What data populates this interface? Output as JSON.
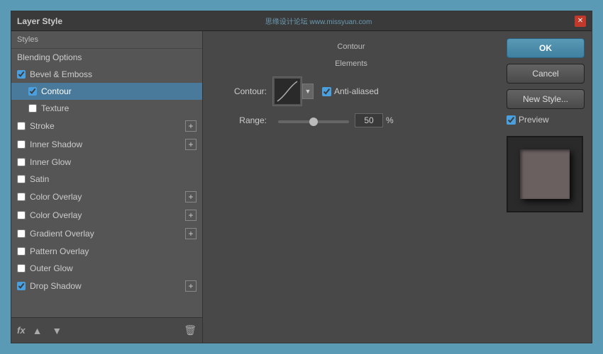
{
  "dialog": {
    "title": "Layer Style",
    "watermark": "思缘设计论坛  www.missyuan.com"
  },
  "left_panel": {
    "header": "Styles",
    "items": [
      {
        "id": "blending-options",
        "label": "Blending Options",
        "checked": null,
        "indent": 0,
        "has_plus": false,
        "active": false
      },
      {
        "id": "bevel-emboss",
        "label": "Bevel & Emboss",
        "checked": true,
        "indent": 0,
        "has_plus": false,
        "active": false
      },
      {
        "id": "contour",
        "label": "Contour",
        "checked": true,
        "indent": 1,
        "has_plus": false,
        "active": true
      },
      {
        "id": "texture",
        "label": "Texture",
        "checked": false,
        "indent": 1,
        "has_plus": false,
        "active": false
      },
      {
        "id": "stroke",
        "label": "Stroke",
        "checked": false,
        "indent": 0,
        "has_plus": true,
        "active": false
      },
      {
        "id": "inner-shadow",
        "label": "Inner Shadow",
        "checked": false,
        "indent": 0,
        "has_plus": true,
        "active": false
      },
      {
        "id": "inner-glow",
        "label": "Inner Glow",
        "checked": false,
        "indent": 0,
        "has_plus": false,
        "active": false
      },
      {
        "id": "satin",
        "label": "Satin",
        "checked": false,
        "indent": 0,
        "has_plus": false,
        "active": false
      },
      {
        "id": "color-overlay-1",
        "label": "Color Overlay",
        "checked": false,
        "indent": 0,
        "has_plus": true,
        "active": false
      },
      {
        "id": "color-overlay-2",
        "label": "Color Overlay",
        "checked": false,
        "indent": 0,
        "has_plus": true,
        "active": false
      },
      {
        "id": "gradient-overlay",
        "label": "Gradient Overlay",
        "checked": false,
        "indent": 0,
        "has_plus": true,
        "active": false
      },
      {
        "id": "pattern-overlay",
        "label": "Pattern Overlay",
        "checked": false,
        "indent": 0,
        "has_plus": false,
        "active": false
      },
      {
        "id": "outer-glow",
        "label": "Outer Glow",
        "checked": false,
        "indent": 0,
        "has_plus": false,
        "active": false
      },
      {
        "id": "drop-shadow",
        "label": "Drop Shadow",
        "checked": true,
        "indent": 0,
        "has_plus": true,
        "active": false
      }
    ],
    "footer": {
      "fx_label": "fx",
      "up_icon": "▲",
      "down_icon": "▼",
      "trash_icon": "🗑"
    }
  },
  "center_panel": {
    "section_title": "Contour",
    "sub_section_title": "Elements",
    "contour_label": "Contour:",
    "anti_aliased_label": "Anti-aliased",
    "anti_aliased_checked": true,
    "range_label": "Range:",
    "range_value": "50",
    "range_percent": "%"
  },
  "right_panel": {
    "ok_label": "OK",
    "cancel_label": "Cancel",
    "new_style_label": "New Style...",
    "preview_label": "Preview",
    "preview_checked": true
  }
}
